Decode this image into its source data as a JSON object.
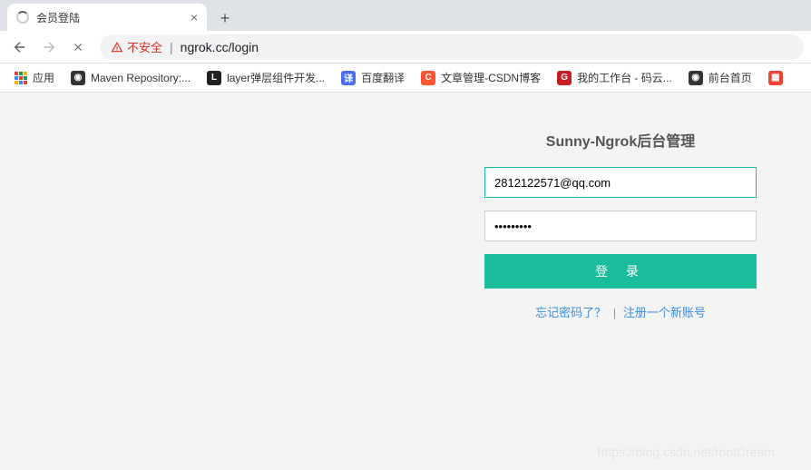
{
  "tab": {
    "title": "会员登陆"
  },
  "address": {
    "insecure_label": "不安全",
    "url": "ngrok.cc/login"
  },
  "bookmarks": {
    "apps": "应用",
    "items": [
      {
        "label": "Maven Repository:..."
      },
      {
        "label": "layer弹层组件开发..."
      },
      {
        "label": "百度翻译"
      },
      {
        "label": "文章管理-CSDN博客"
      },
      {
        "label": "我的工作台 - 码云..."
      },
      {
        "label": "前台首页"
      }
    ]
  },
  "login": {
    "title": "Sunny-Ngrok后台管理",
    "email_value": "2812122571@qq.com",
    "password_value": "•••••••••",
    "submit_label": "登 录",
    "forgot_label": "忘记密码了？",
    "sep": "|",
    "register_label": "注册一个新账号"
  },
  "watermark": "https://blog.csdn.net/rootDream"
}
